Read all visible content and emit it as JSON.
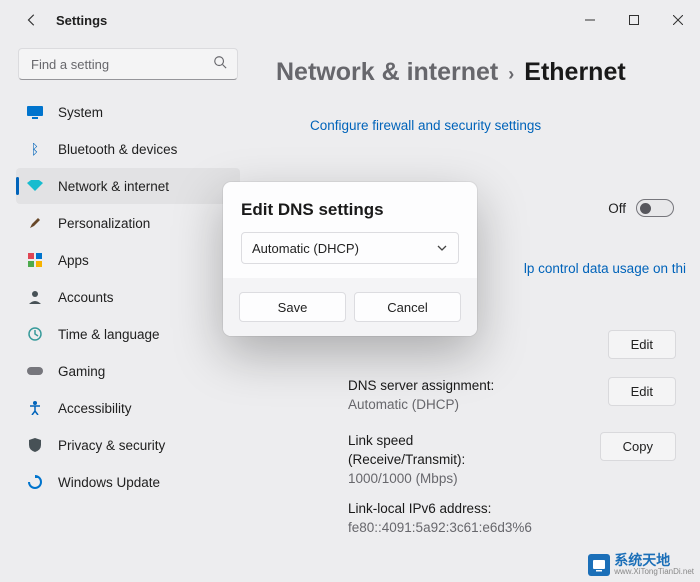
{
  "window": {
    "title": "Settings"
  },
  "search": {
    "placeholder": "Find a setting"
  },
  "sidebar": {
    "items": [
      {
        "label": "System",
        "icon": "monitor",
        "color": "#0078d4"
      },
      {
        "label": "Bluetooth & devices",
        "icon": "bluetooth",
        "color": "#0067c0"
      },
      {
        "label": "Network & internet",
        "icon": "wifi",
        "color": "#00b7c3",
        "active": true
      },
      {
        "label": "Personalization",
        "icon": "brush",
        "color": "#5a4131"
      },
      {
        "label": "Apps",
        "icon": "apps",
        "color": "#e74856"
      },
      {
        "label": "Accounts",
        "icon": "person",
        "color": "#4a5459"
      },
      {
        "label": "Time & language",
        "icon": "clock",
        "color": "#3aa0a0"
      },
      {
        "label": "Gaming",
        "icon": "game",
        "color": "#7a7a80"
      },
      {
        "label": "Accessibility",
        "icon": "accessibility",
        "color": "#0067c0"
      },
      {
        "label": "Privacy & security",
        "icon": "shield",
        "color": "#4a5459"
      },
      {
        "label": "Windows Update",
        "icon": "update",
        "color": "#0078d4"
      }
    ]
  },
  "breadcrumb": {
    "parent": "Network & internet",
    "current": "Ethernet"
  },
  "main": {
    "firewall_link": "Configure firewall and security settings",
    "toggle_label": "Off",
    "usage_hint": "lp control data usage on thi",
    "rows": [
      {
        "label": "",
        "sub": "",
        "button": "Edit"
      },
      {
        "label": "DNS server assignment:",
        "sub": "Automatic (DHCP)",
        "button": "Edit"
      },
      {
        "label": "Link speed (Receive/Transmit):",
        "sub": "1000/1000 (Mbps)",
        "button": "Copy"
      },
      {
        "label": "Link-local IPv6 address:",
        "sub": "fe80::4091:5a92:3c61:e6d3%6",
        "button": ""
      }
    ]
  },
  "dialog": {
    "title": "Edit DNS settings",
    "dropdown_value": "Automatic (DHCP)",
    "save": "Save",
    "cancel": "Cancel"
  },
  "watermark": {
    "brand": "系统天地",
    "url": "www.XiTongTianDi.net"
  }
}
